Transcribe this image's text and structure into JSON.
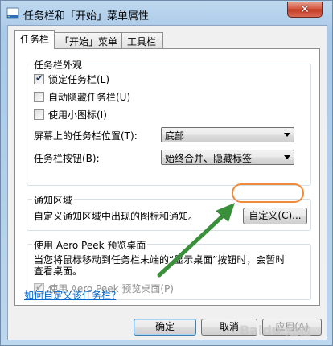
{
  "window": {
    "title": "任务栏和「开始」菜单属性",
    "close_label": "✕"
  },
  "tabs": [
    {
      "label": "任务栏"
    },
    {
      "label": "「开始」菜单"
    },
    {
      "label": "工具栏"
    }
  ],
  "appearance": {
    "title": "任务栏外观",
    "lock": {
      "label": "锁定任务栏(L)",
      "checked": true
    },
    "autohide": {
      "label": "自动隐藏任务栏(U)",
      "checked": false
    },
    "small_icons": {
      "label": "使用小图标(I)",
      "checked": false
    },
    "position_label": "屏幕上的任务栏位置(T):",
    "position_value": "底部",
    "buttons_label": "任务栏按钮(B):",
    "buttons_value": "始终合并、隐藏标签"
  },
  "notification": {
    "title": "通知区域",
    "description": "自定义通知区域中出现的图标和通知。",
    "customize_button": "自定义(C)..."
  },
  "aero_peek": {
    "title": "使用 Aero Peek 预览桌面",
    "description_line1": "当您将鼠标移动到任务栏末端的“显示桌面”按钮时，会暂时",
    "description_line2": "查看桌面。",
    "checkbox_label": "使用 Aero Peek 预览桌面(P)",
    "checked": true
  },
  "help_link": "如何自定义该任务栏?",
  "footer": {
    "ok": "确定",
    "cancel": "取消",
    "apply": "应用(A)"
  },
  "watermark_text": "Baidu 经验",
  "colors": {
    "annotation": "#f08a3a",
    "arrow": "#3a8f3a",
    "link": "#0066cc"
  }
}
